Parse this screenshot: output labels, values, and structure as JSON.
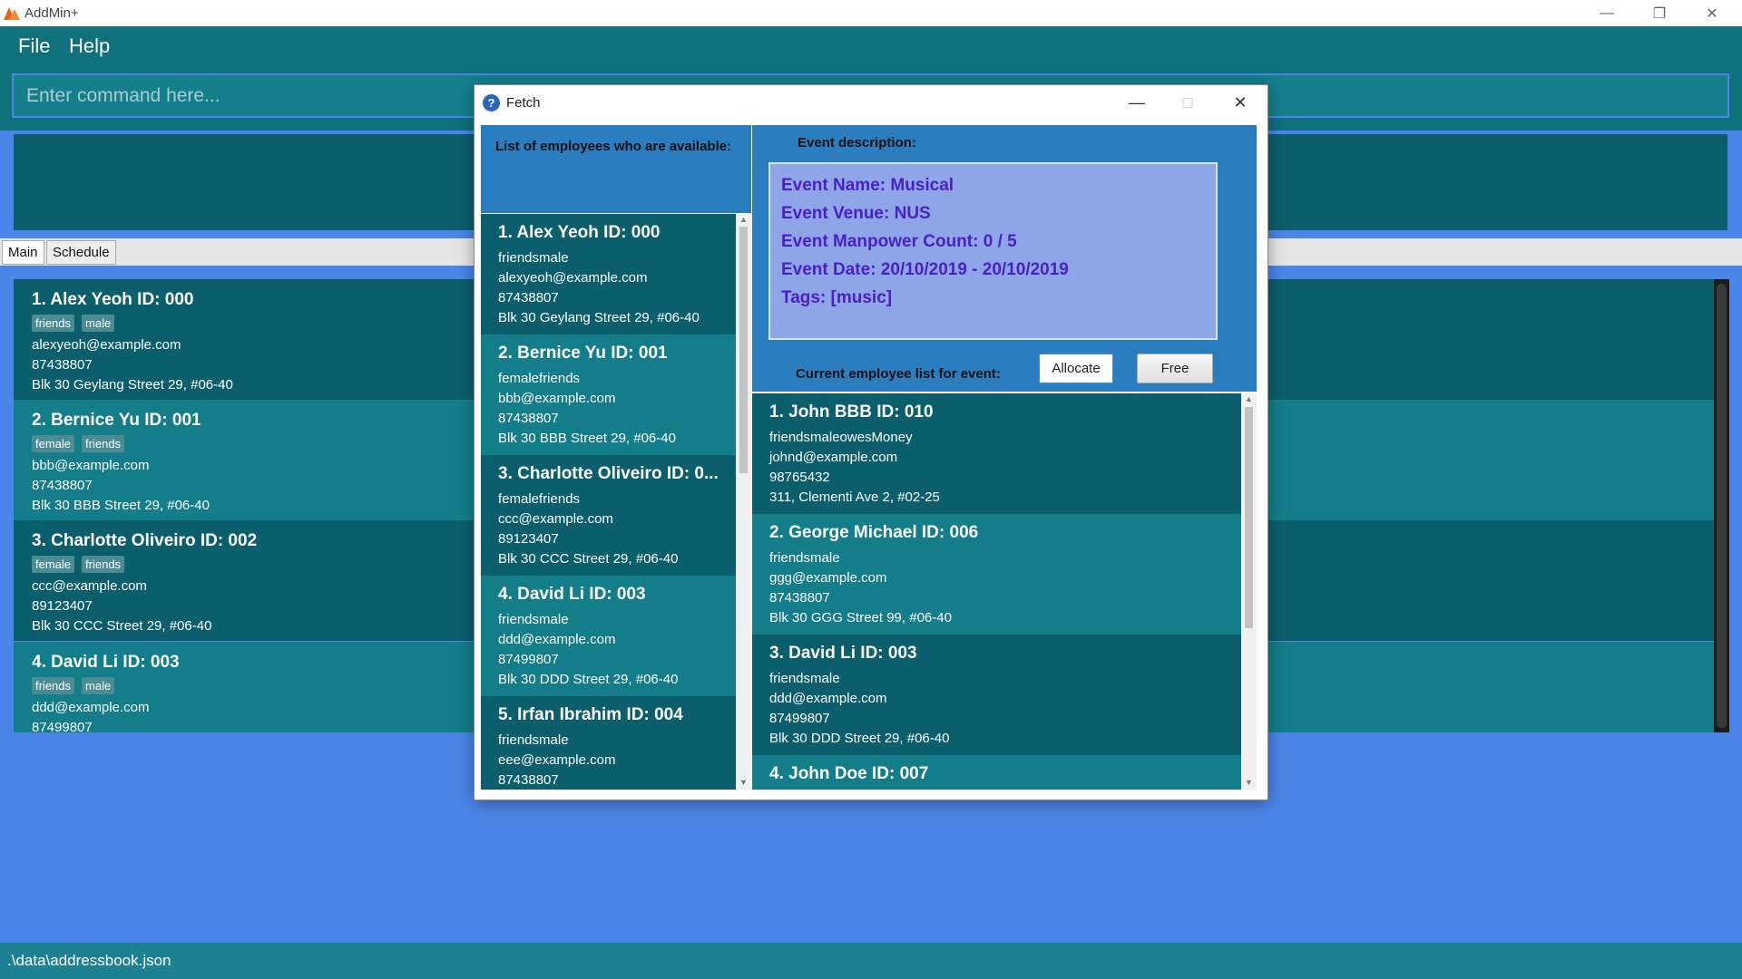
{
  "app": {
    "title": "AddMin+"
  },
  "menu": {
    "file": "File",
    "help": "Help"
  },
  "command": {
    "placeholder": "Enter command here..."
  },
  "tabs": [
    {
      "label": "Main"
    },
    {
      "label": "Schedule"
    }
  ],
  "persons": [
    {
      "header": "1.  Alex Yeoh ID: 000",
      "tags": [
        "friends",
        "male"
      ],
      "email": "alexyeoh@example.com",
      "phone": "87438807",
      "address": "Blk 30 Geylang Street 29, #06-40"
    },
    {
      "header": "2.  Bernice Yu ID: 001",
      "tags": [
        "female",
        "friends"
      ],
      "email": "bbb@example.com",
      "phone": "87438807",
      "address": "Blk 30 BBB Street 29, #06-40"
    },
    {
      "header": "3.  Charlotte Oliveiro ID: 002",
      "tags": [
        "female",
        "friends"
      ],
      "email": "ccc@example.com",
      "phone": "89123407",
      "address": "Blk 30 CCC Street 29, #06-40"
    },
    {
      "header": "4.  David Li ID: 003",
      "tags": [
        "friends",
        "male"
      ],
      "email": "ddd@example.com",
      "phone": "87499807",
      "address": ""
    }
  ],
  "status": {
    "path": ".\\data\\addressbook.json"
  },
  "fetch": {
    "title": "Fetch",
    "available_label": "List of employees who are available:",
    "available": [
      {
        "header": "1.  Alex Yeoh ID: 000",
        "tags": "friendsmale",
        "email": "alexyeoh@example.com",
        "phone": "87438807",
        "address": "Blk 30 Geylang Street 29, #06-40"
      },
      {
        "header": "2.  Bernice Yu ID: 001",
        "tags": "femalefriends",
        "email": "bbb@example.com",
        "phone": "87438807",
        "address": "Blk 30 BBB Street 29, #06-40"
      },
      {
        "header": "3.  Charlotte Oliveiro ID: 0...",
        "tags": "femalefriends",
        "email": "ccc@example.com",
        "phone": "89123407",
        "address": "Blk 30 CCC Street 29, #06-40"
      },
      {
        "header": "4.  David Li ID: 003",
        "tags": "friendsmale",
        "email": "ddd@example.com",
        "phone": "87499807",
        "address": "Blk 30 DDD Street 29, #06-40"
      },
      {
        "header": "5.  Irfan Ibrahim ID: 004",
        "tags": "friendsmale",
        "email": "eee@example.com",
        "phone": "87438807",
        "address": ""
      }
    ],
    "event_label": "Event description:",
    "event": {
      "name": "Event Name: Musical",
      "venue": "Event Venue: NUS",
      "manpower": "Event Manpower Count: 0 / 5",
      "date": "Event Date: 20/10/2019 - 20/10/2019",
      "tags": "Tags: [music]"
    },
    "current_label": "Current employee list for event:",
    "allocate_label": "Allocate",
    "free_label": "Free",
    "allocated": [
      {
        "header": "1.  John BBB ID: 010",
        "tags": "friendsmaleowesMoney",
        "email": "johnd@example.com",
        "phone": "98765432",
        "address": "311, Clementi Ave 2, #02-25"
      },
      {
        "header": "2.  George Michael ID: 006",
        "tags": "friendsmale",
        "email": "ggg@example.com",
        "phone": "87438807",
        "address": "Blk 30 GGG Street 99, #06-40"
      },
      {
        "header": "3.  David Li ID: 003",
        "tags": "friendsmale",
        "email": "ddd@example.com",
        "phone": "87499807",
        "address": "Blk 30 DDD Street 29, #06-40"
      },
      {
        "header": "4.  John Doe ID: 007",
        "tags": "",
        "email": "",
        "phone": "",
        "address": ""
      }
    ]
  }
}
